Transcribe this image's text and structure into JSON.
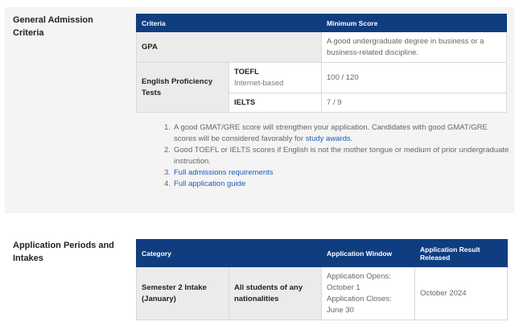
{
  "general": {
    "title": "General Admission Criteria",
    "table": {
      "headers": [
        "Criteria",
        "Minimum Score"
      ],
      "gpa": {
        "label": "GPA",
        "value": "A good undergraduate degree in business or a business-related discipline."
      },
      "english": {
        "label": "English Proficiency Tests",
        "toefl": {
          "name": "TOEFL",
          "sub": "Internet-based",
          "value": "100 / 120"
        },
        "ielts": {
          "name": "IELTS",
          "value": "7 / 9"
        }
      }
    },
    "notes": [
      {
        "num": "1.",
        "text": "A good GMAT/GRE score will strengthen your application. Candidates with good GMAT/GRE scores will be considered favorably for ",
        "link": "study awards",
        "after": "."
      },
      {
        "num": "2.",
        "text": "Good TOEFL or IELTS scores if English is not the mother tongue or medium of prior undergraduate instruction."
      },
      {
        "num": "3.",
        "link": "Full admissions requirements"
      },
      {
        "num": "4.",
        "link": "Full application guide"
      }
    ]
  },
  "periods": {
    "title": "Application Periods and Intakes",
    "headers": [
      "Category",
      "Application Window",
      "Application Result Released"
    ],
    "rows": [
      {
        "intake": "Semester 2 Intake (January)",
        "eligibility": "All students of any nationalities",
        "window_open": "Application Opens: October 1",
        "window_close": "Application Closes: June 30",
        "result": "October 2024"
      }
    ]
  },
  "colors": {
    "header_bg": "#0f3d80",
    "link": "#1b5fb7",
    "section_bg": "#f4f4f4"
  }
}
